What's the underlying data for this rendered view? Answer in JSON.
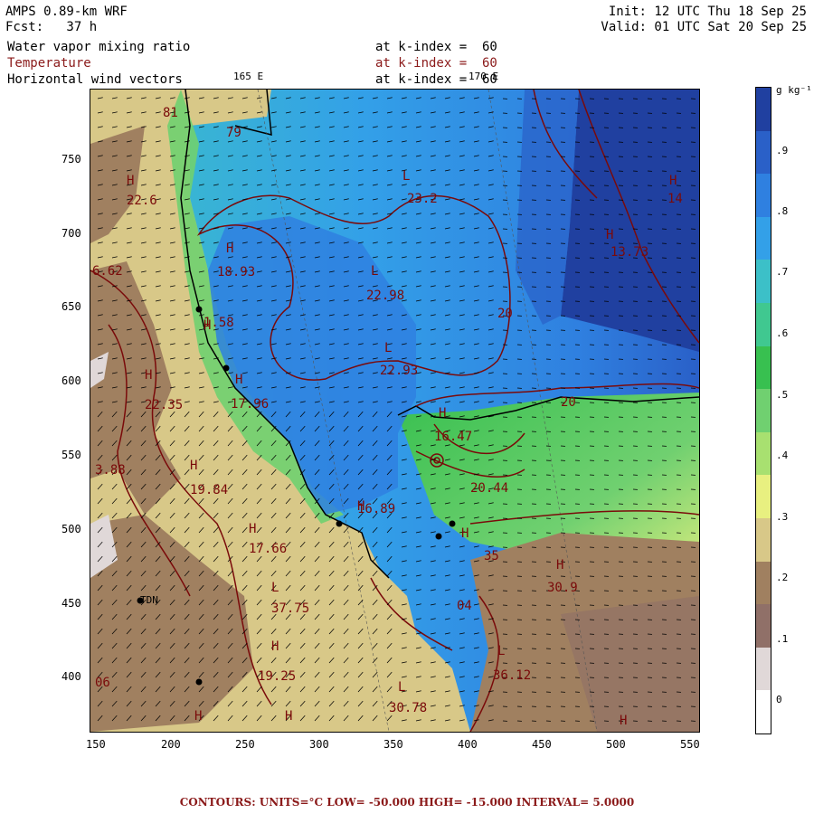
{
  "header": {
    "model": "AMPS 0.89-km WRF",
    "fcst": "Fcst:   37 h",
    "init": "Init: 12 UTC Thu 18 Sep 25",
    "valid": "Valid: 01 UTC Sat 20 Sep 25",
    "field1": "Water vapor mixing ratio",
    "field2": "Temperature",
    "field3": "Horizontal wind vectors",
    "level1": "at k-index =  60",
    "level2": "at k-index =  60",
    "level3": "at k-index =  60",
    "lon_label_1": "165 E",
    "lon_label_2": "170 E"
  },
  "axes": {
    "x_ticks": [
      "150",
      "200",
      "250",
      "300",
      "350",
      "400",
      "450",
      "500",
      "550"
    ],
    "y_ticks": [
      "750",
      "700",
      "650",
      "600",
      "550",
      "500",
      "450",
      "400"
    ]
  },
  "colorbar": {
    "unit": "g kg⁻¹",
    "labels": [
      ".9",
      ".8",
      ".7",
      ".6",
      ".5",
      ".4",
      ".3",
      ".2",
      ".1",
      "0"
    ],
    "colors": [
      "#2040a0",
      "#2a60c8",
      "#2f80e0",
      "#33a0e8",
      "#3cc0c8",
      "#40c890",
      "#38c050",
      "#70d070",
      "#a8e070",
      "#e8f080",
      "#d8c888",
      "#a08060",
      "#907068",
      "#e0d8d8",
      "#ffffff"
    ]
  },
  "map": {
    "labels": [
      {
        "t": "81",
        "c": "red"
      },
      {
        "t": "79",
        "c": "red"
      },
      {
        "t": "H",
        "c": "red"
      },
      {
        "t": "22.6",
        "c": "red"
      },
      {
        "t": "H",
        "c": "red"
      },
      {
        "t": "18.93",
        "c": "red"
      },
      {
        "t": "6.62",
        "c": "red"
      },
      {
        "t": "H",
        "c": "red"
      },
      {
        "t": "1.58",
        "c": "red"
      },
      {
        "t": "L",
        "c": "red"
      },
      {
        "t": "23.2",
        "c": "red"
      },
      {
        "t": "L",
        "c": "red"
      },
      {
        "t": "22.98",
        "c": "red"
      },
      {
        "t": "L",
        "c": "red"
      },
      {
        "t": "22.93",
        "c": "red"
      },
      {
        "t": "20",
        "c": "red"
      },
      {
        "t": "H",
        "c": "red"
      },
      {
        "t": "14",
        "c": "red"
      },
      {
        "t": "H",
        "c": "red"
      },
      {
        "t": "13.73",
        "c": "red"
      },
      {
        "t": "20",
        "c": "red"
      },
      {
        "t": "H",
        "c": "red"
      },
      {
        "t": "22.35",
        "c": "red"
      },
      {
        "t": "H",
        "c": "red"
      },
      {
        "t": "17.96",
        "c": "red"
      },
      {
        "t": "H",
        "c": "red"
      },
      {
        "t": "16.47",
        "c": "red"
      },
      {
        "t": "3.88",
        "c": "red"
      },
      {
        "t": "H",
        "c": "red"
      },
      {
        "t": "19.84",
        "c": "red"
      },
      {
        "t": "20.44",
        "c": "red"
      },
      {
        "t": "H",
        "c": "red"
      },
      {
        "t": "16.89",
        "c": "red"
      },
      {
        "t": "H",
        "c": "red"
      },
      {
        "t": "17.66",
        "c": "red"
      },
      {
        "t": "H",
        "c": "red"
      },
      {
        "t": "35",
        "c": "red"
      },
      {
        "t": "H",
        "c": "red"
      },
      {
        "t": "30.9",
        "c": "red"
      },
      {
        "t": "L",
        "c": "red"
      },
      {
        "t": "37.75",
        "c": "red"
      },
      {
        "t": "04",
        "c": "red"
      },
      {
        "t": "TDN",
        "c": "black"
      },
      {
        "t": "H",
        "c": "red"
      },
      {
        "t": "19.25",
        "c": "red"
      },
      {
        "t": "L",
        "c": "red"
      },
      {
        "t": "36.12",
        "c": "red"
      },
      {
        "t": "L",
        "c": "red"
      },
      {
        "t": "30.78",
        "c": "red"
      },
      {
        "t": "06",
        "c": "red"
      },
      {
        "t": "H",
        "c": "red"
      },
      {
        "t": "H",
        "c": "red"
      },
      {
        "t": "H",
        "c": "red"
      }
    ]
  },
  "footer": "CONTOURS:  UNITS=°C  LOW= -50.000      HIGH= -15.000      INTERVAL=   5.0000"
}
